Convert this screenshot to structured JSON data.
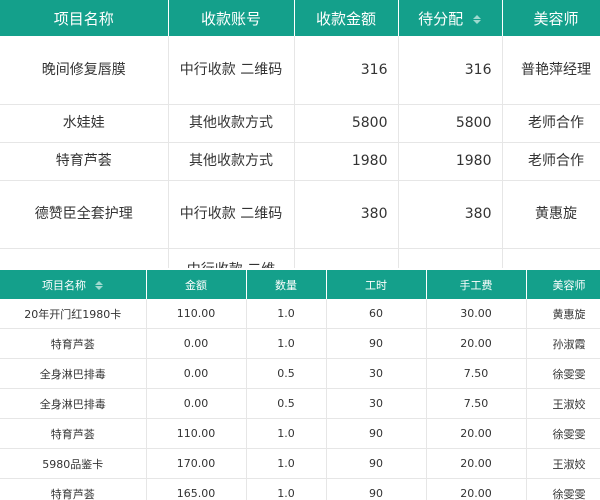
{
  "top_table": {
    "headers": [
      "项目名称",
      "收款账号",
      "收款金额",
      "待分配",
      "美容师"
    ],
    "rows": [
      [
        "晚间修复唇膜",
        "中行收款 二维码",
        "316",
        "316",
        "普艳萍经理"
      ],
      [
        "水娃娃",
        "其他收款方式",
        "5800",
        "5800",
        "老师合作"
      ],
      [
        "特育芦荟",
        "其他收款方式",
        "1980",
        "1980",
        "老师合作"
      ],
      [
        "德赞臣全套护理",
        "中行收款 二维码",
        "380",
        "380",
        "黄惠旋"
      ],
      [
        "",
        "中行收款 二维",
        "",
        "",
        ""
      ]
    ]
  },
  "bottom_table": {
    "headers": [
      "项目名称",
      "金额",
      "数量",
      "工时",
      "手工费",
      "美容师"
    ],
    "rows": [
      [
        "20年开门红1980卡",
        "110.00",
        "1.0",
        "60",
        "30.00",
        "黄惠旋"
      ],
      [
        "特育芦荟",
        "0.00",
        "1.0",
        "90",
        "20.00",
        "孙淑霞"
      ],
      [
        "全身淋巴排毒",
        "0.00",
        "0.5",
        "30",
        "7.50",
        "徐雯雯"
      ],
      [
        "全身淋巴排毒",
        "0.00",
        "0.5",
        "30",
        "7.50",
        "王淑姣"
      ],
      [
        "特育芦荟",
        "110.00",
        "1.0",
        "90",
        "20.00",
        "徐雯雯"
      ],
      [
        "5980品鉴卡",
        "170.00",
        "1.0",
        "90",
        "20.00",
        "王淑姣"
      ],
      [
        "特育芦荟",
        "165.00",
        "1.0",
        "90",
        "20.00",
        "徐雯雯"
      ]
    ]
  },
  "colors": {
    "header_bg": "#14a08b",
    "header_text": "#ffffff",
    "border": "#e6e6e6"
  },
  "icons": {
    "sort": "sort-icon"
  }
}
